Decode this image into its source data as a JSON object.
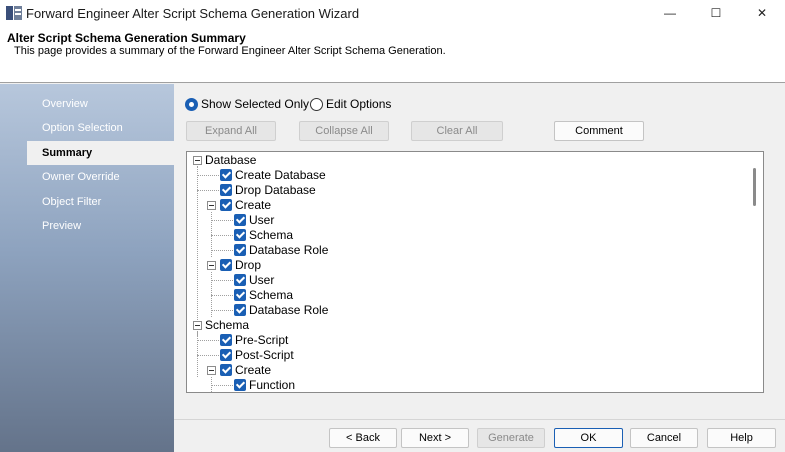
{
  "window": {
    "title": "Forward Engineer Alter Script Schema Generation Wizard",
    "minimize": "—",
    "maximize": "☐",
    "close": "✕"
  },
  "header": {
    "title": "Alter Script Schema Generation Summary",
    "description": "This page provides a summary of the Forward Engineer Alter Script Schema Generation."
  },
  "sidebar": {
    "items": [
      {
        "label": "Overview"
      },
      {
        "label": "Option Selection"
      },
      {
        "label": "Summary",
        "active": true
      },
      {
        "label": "Owner Override"
      },
      {
        "label": "Object Filter"
      },
      {
        "label": "Preview"
      }
    ]
  },
  "view_mode": {
    "show_selected_only": "Show Selected Only",
    "edit_options": "Edit Options",
    "selected": "show_selected_only"
  },
  "toolbar": {
    "expand_all": "Expand All",
    "collapse_all": "Collapse All",
    "clear_all": "Clear All",
    "comment": "Comment"
  },
  "tree": {
    "nodes": [
      {
        "label": "Database",
        "level": 0,
        "expandable": true,
        "checkbox": false
      },
      {
        "label": "Create Database",
        "level": 1,
        "expandable": false,
        "checkbox": true
      },
      {
        "label": "Drop Database",
        "level": 1,
        "expandable": false,
        "checkbox": true
      },
      {
        "label": "Create",
        "level": 1,
        "expandable": true,
        "checkbox": true
      },
      {
        "label": "User",
        "level": 2,
        "expandable": false,
        "checkbox": true
      },
      {
        "label": "Schema",
        "level": 2,
        "expandable": false,
        "checkbox": true
      },
      {
        "label": "Database Role",
        "level": 2,
        "expandable": false,
        "checkbox": true
      },
      {
        "label": "Drop",
        "level": 1,
        "expandable": true,
        "checkbox": true
      },
      {
        "label": "User",
        "level": 2,
        "expandable": false,
        "checkbox": true
      },
      {
        "label": "Schema",
        "level": 2,
        "expandable": false,
        "checkbox": true
      },
      {
        "label": "Database Role",
        "level": 2,
        "expandable": false,
        "checkbox": true
      },
      {
        "label": "Schema",
        "level": 0,
        "expandable": true,
        "checkbox": false
      },
      {
        "label": "Pre-Script",
        "level": 1,
        "expandable": false,
        "checkbox": true
      },
      {
        "label": "Post-Script",
        "level": 1,
        "expandable": false,
        "checkbox": true
      },
      {
        "label": "Create",
        "level": 1,
        "expandable": true,
        "checkbox": true
      },
      {
        "label": "Function",
        "level": 2,
        "expandable": false,
        "checkbox": true
      }
    ]
  },
  "footer": {
    "back": "< Back",
    "next": "Next >",
    "generate": "Generate",
    "ok": "OK",
    "cancel": "Cancel",
    "help": "Help"
  }
}
